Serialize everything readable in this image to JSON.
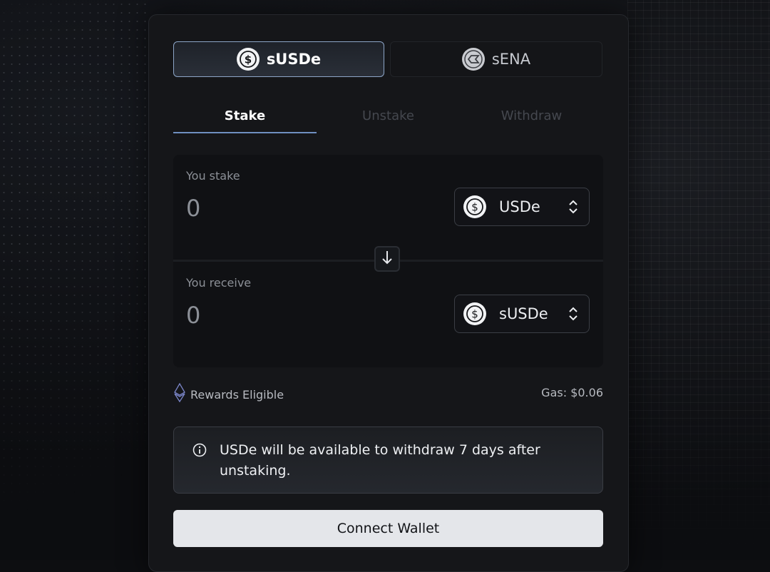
{
  "token_tabs": [
    {
      "label": "sUSDe",
      "icon": "usde-coin-icon",
      "active": true
    },
    {
      "label": "sENA",
      "icon": "ena-coin-icon",
      "active": false
    }
  ],
  "action_tabs": [
    {
      "label": "Stake",
      "active": true
    },
    {
      "label": "Unstake",
      "active": false
    },
    {
      "label": "Withdraw",
      "active": false
    }
  ],
  "stake": {
    "label": "You stake",
    "value": "0",
    "token": "USDe"
  },
  "receive": {
    "label": "You receive",
    "value": "0",
    "token": "sUSDe"
  },
  "rewards_label": "Rewards Eligible",
  "gas_label": "Gas: $0.06",
  "notice": "USDe will be available to withdraw 7 days after unstaking.",
  "connect_label": "Connect Wallet",
  "colors": {
    "accent_border": "#8da6c8",
    "tab_underline": "#6f8fc0",
    "button_bg": "#e4e6ea"
  }
}
